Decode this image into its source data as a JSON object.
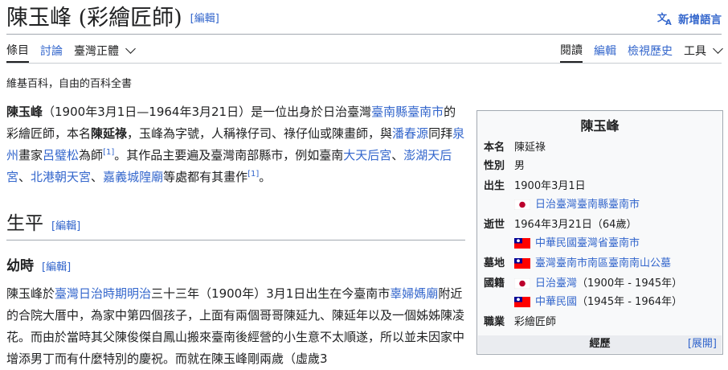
{
  "title": {
    "text": "陳玉峰 (彩繪匠師)",
    "edit": "[編輯]",
    "lang_button": "新增語言"
  },
  "tabs": {
    "article": "條目",
    "talk": "討論",
    "variant": "臺灣正體",
    "read": "閱讀",
    "edit": "編輯",
    "history": "檢視歷史",
    "tools": "工具"
  },
  "tagline": "維基百科，自由的百科全書",
  "lead": {
    "name": "陳玉峰",
    "dates": "（1900年3月1日—1964年3月21日）是一位出身於日治臺灣",
    "link_tainan": "臺南縣臺南市",
    "t1": "的彩繪匠師，本名",
    "bold_name": "陳延祿",
    "t2": "，玉峰為字號，人稱祿仔司、祿仔仙或陳畫師，與",
    "link_pan": "潘春源",
    "t3": "同拜",
    "link_quanzhou": "泉州",
    "t4": "畫家",
    "link_lu": "呂璧松",
    "t5": "為師",
    "ref": "[1]",
    "t6": "。其作品主要遍及臺灣南部縣市，例如臺南",
    "link_datian": "大天后宮",
    "sep1": "、",
    "link_penghu": "澎湖天后宮",
    "sep2": "、",
    "link_beigang": "北港朝天宮",
    "sep3": "、",
    "link_chiayi": "嘉義城隍廟",
    "t7": "等處都有其畫作",
    "ref2": "[1]",
    "t8": "。"
  },
  "section": {
    "h2": "生平",
    "h2_edit": "[編輯]",
    "h3": "幼時",
    "h3_edit": "[編輯]"
  },
  "body": {
    "t1": "陳玉峰於",
    "link_era": "臺灣日治時期明治",
    "t2": "三十三年（1900年）3月1日出生在今臺南市",
    "link_temple": "辜婦媽廟",
    "t3": "附近的合院大厝中，為家中第四個孩子，上面有兩個哥哥陳延九、陳延年以及一個姊姊陳凌花。而由於當時其父陳俊傑自鳳山搬來臺南後經營的小生意不太順遂，所以並未因家中增添男丁而有什麼特別的慶祝。而就在陳玉峰剛兩歲（虛歲3"
  },
  "infobox": {
    "title": "陳玉峰",
    "name_label": "本名",
    "name_value": "陳延祿",
    "gender_label": "性別",
    "gender_value": "男",
    "born_label": "出生",
    "born_date": "1900年3月1日",
    "born_place": "日治臺灣臺南縣臺南市",
    "died_label": "逝世",
    "died_date": "1964年3月21日（64歲）",
    "died_place": "中華民國臺灣省臺南市",
    "burial_label": "墓地",
    "burial_value": "臺灣臺南市南區臺南南山公墓",
    "nationality_label": "國籍",
    "nat1_link": "日治臺灣",
    "nat1_years": "（1900年 - 1945年）",
    "nat2_link": "中華民國",
    "nat2_years": "（1945年 - 1964年）",
    "occupation_label": "職業",
    "occupation_value": "彩繪匠師",
    "footer": "經歷",
    "toggle": "[展開]"
  },
  "colors": {
    "link": "#3366cc",
    "text": "#202122",
    "infobox_bg": "#f8f9fa",
    "border": "#a2a9b1"
  }
}
